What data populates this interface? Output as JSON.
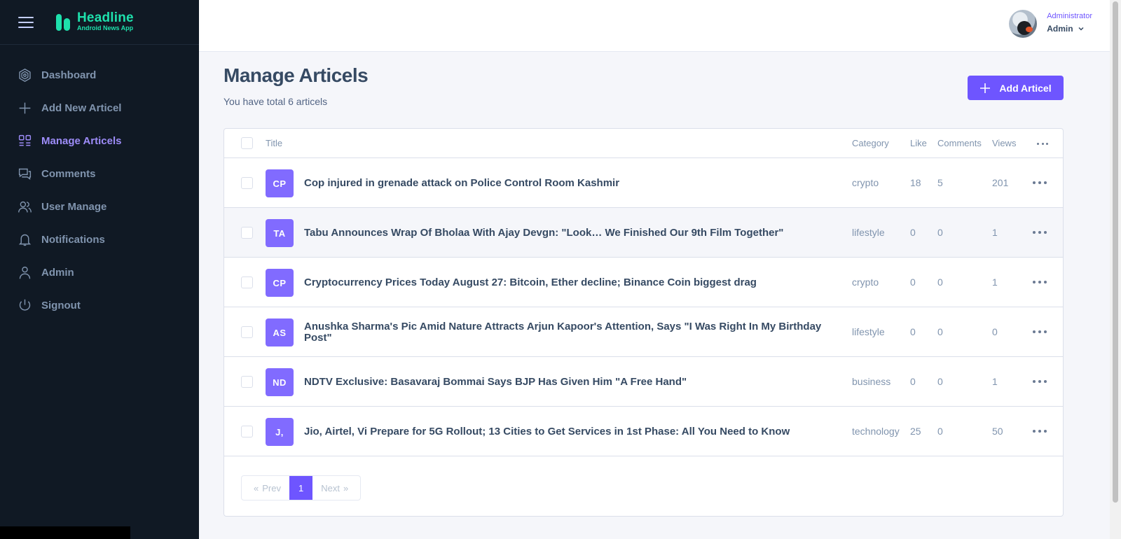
{
  "app": {
    "brand": "Headline",
    "tagline": "Android News App"
  },
  "sidebar": {
    "items": [
      {
        "label": "Dashboard",
        "icon": "dashboard-icon",
        "active": false
      },
      {
        "label": "Add New Articel",
        "icon": "plus-icon",
        "active": false
      },
      {
        "label": "Manage Articels",
        "icon": "grid-icon",
        "active": true
      },
      {
        "label": "Comments",
        "icon": "comments-icon",
        "active": false
      },
      {
        "label": "User Manage",
        "icon": "users-icon",
        "active": false
      },
      {
        "label": "Notifications",
        "icon": "bell-icon",
        "active": false
      },
      {
        "label": "Admin",
        "icon": "user-icon",
        "active": false
      },
      {
        "label": "Signout",
        "icon": "power-icon",
        "active": false
      }
    ]
  },
  "user": {
    "role": "Administrator",
    "name": "Admin"
  },
  "page": {
    "title": "Manage Articels",
    "subtitle": "You have total 6 articels",
    "add_button": "Add Articel"
  },
  "table": {
    "headers": {
      "title": "Title",
      "category": "Category",
      "like": "Like",
      "comments": "Comments",
      "views": "Views"
    },
    "rows": [
      {
        "abbr": "CP",
        "title": "Cop injured in grenade attack on Police Control Room Kashmir",
        "category": "crypto",
        "like": "18",
        "comments": "5",
        "views": "201"
      },
      {
        "abbr": "TA",
        "title": "Tabu Announces Wrap Of Bholaa With Ajay Devgn: \"Look… We Finished Our 9th Film Together\"",
        "category": "lifestyle",
        "like": "0",
        "comments": "0",
        "views": "1"
      },
      {
        "abbr": "CP",
        "title": "Cryptocurrency Prices Today August 27: Bitcoin, Ether decline; Binance Coin biggest drag",
        "category": "crypto",
        "like": "0",
        "comments": "0",
        "views": "1"
      },
      {
        "abbr": "AS",
        "title": "Anushka Sharma's Pic Amid Nature Attracts Arjun Kapoor's Attention, Says \"I Was Right In My Birthday Post\"",
        "category": "lifestyle",
        "like": "0",
        "comments": "0",
        "views": "0"
      },
      {
        "abbr": "ND",
        "title": "NDTV Exclusive: Basavaraj Bommai Says BJP Has Given Him \"A Free Hand\"",
        "category": "business",
        "like": "0",
        "comments": "0",
        "views": "1"
      },
      {
        "abbr": "J,",
        "title": "Jio, Airtel, Vi Prepare for 5G Rollout; 13 Cities to Get Services in 1st Phase: All You Need to Know",
        "category": "technology",
        "like": "25",
        "comments": "0",
        "views": "50"
      }
    ]
  },
  "pagination": {
    "prev": "Prev",
    "current": "1",
    "next": "Next"
  },
  "colors": {
    "accent": "#6e55ff",
    "sidebar_bg": "#101924",
    "brand": "#1ee0ac"
  }
}
